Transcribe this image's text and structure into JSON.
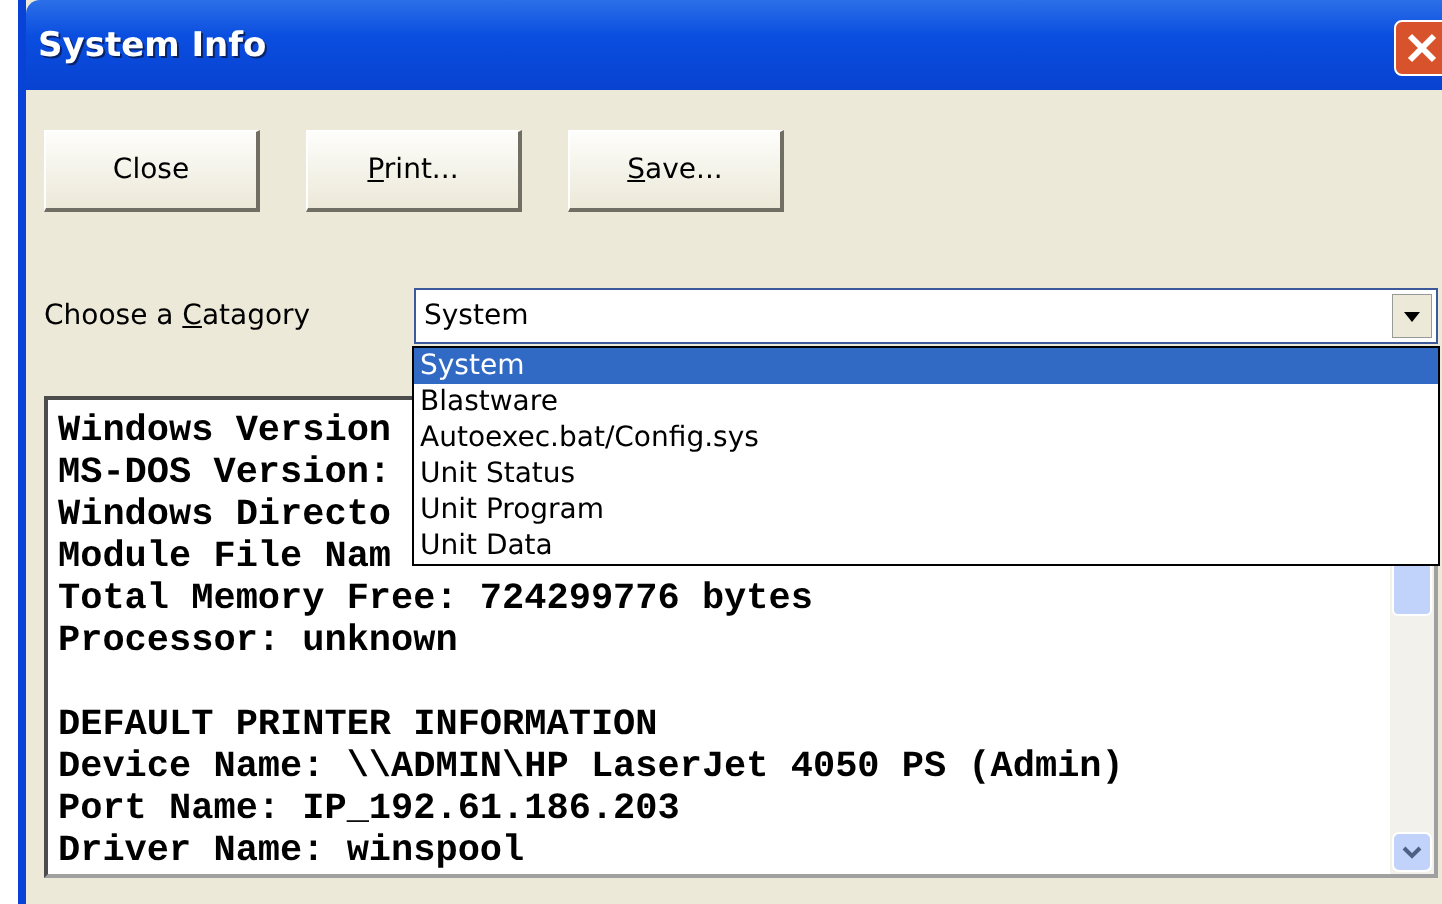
{
  "window": {
    "title": "System Info"
  },
  "buttons": [
    {
      "label": "Close"
    },
    {
      "label": "rint...",
      "mnemonic": "P"
    },
    {
      "label": "ave...",
      "mnemonic": "S"
    }
  ],
  "category": {
    "label_start": "Choose a ",
    "mnemonic": "C",
    "label": "atagory",
    "value": "System",
    "expanded": true,
    "options": [
      {
        "label": "System",
        "selected": true
      },
      {
        "label": "Blastware",
        "selected": false
      },
      {
        "label": "Autoexec.bat/Config.sys",
        "selected": false
      },
      {
        "label": "Unit Status",
        "selected": false
      },
      {
        "label": "Unit Program",
        "selected": false
      },
      {
        "label": "Unit Data",
        "selected": false
      }
    ]
  },
  "system_lines": [
    "Windows Version",
    "MS-DOS Version:",
    "Windows Directo",
    "Module File Nam",
    "Total Memory Free: 724299776 bytes",
    "Processor: unknown"
  ],
  "printer_lines": [
    "DEFAULT PRINTER INFORMATION",
    "Device Name: \\\\ADMIN\\HP LaserJet 4050 PS (Admin)",
    "Port Name: IP_192.61.186.203",
    "Driver Name: winspool"
  ]
}
